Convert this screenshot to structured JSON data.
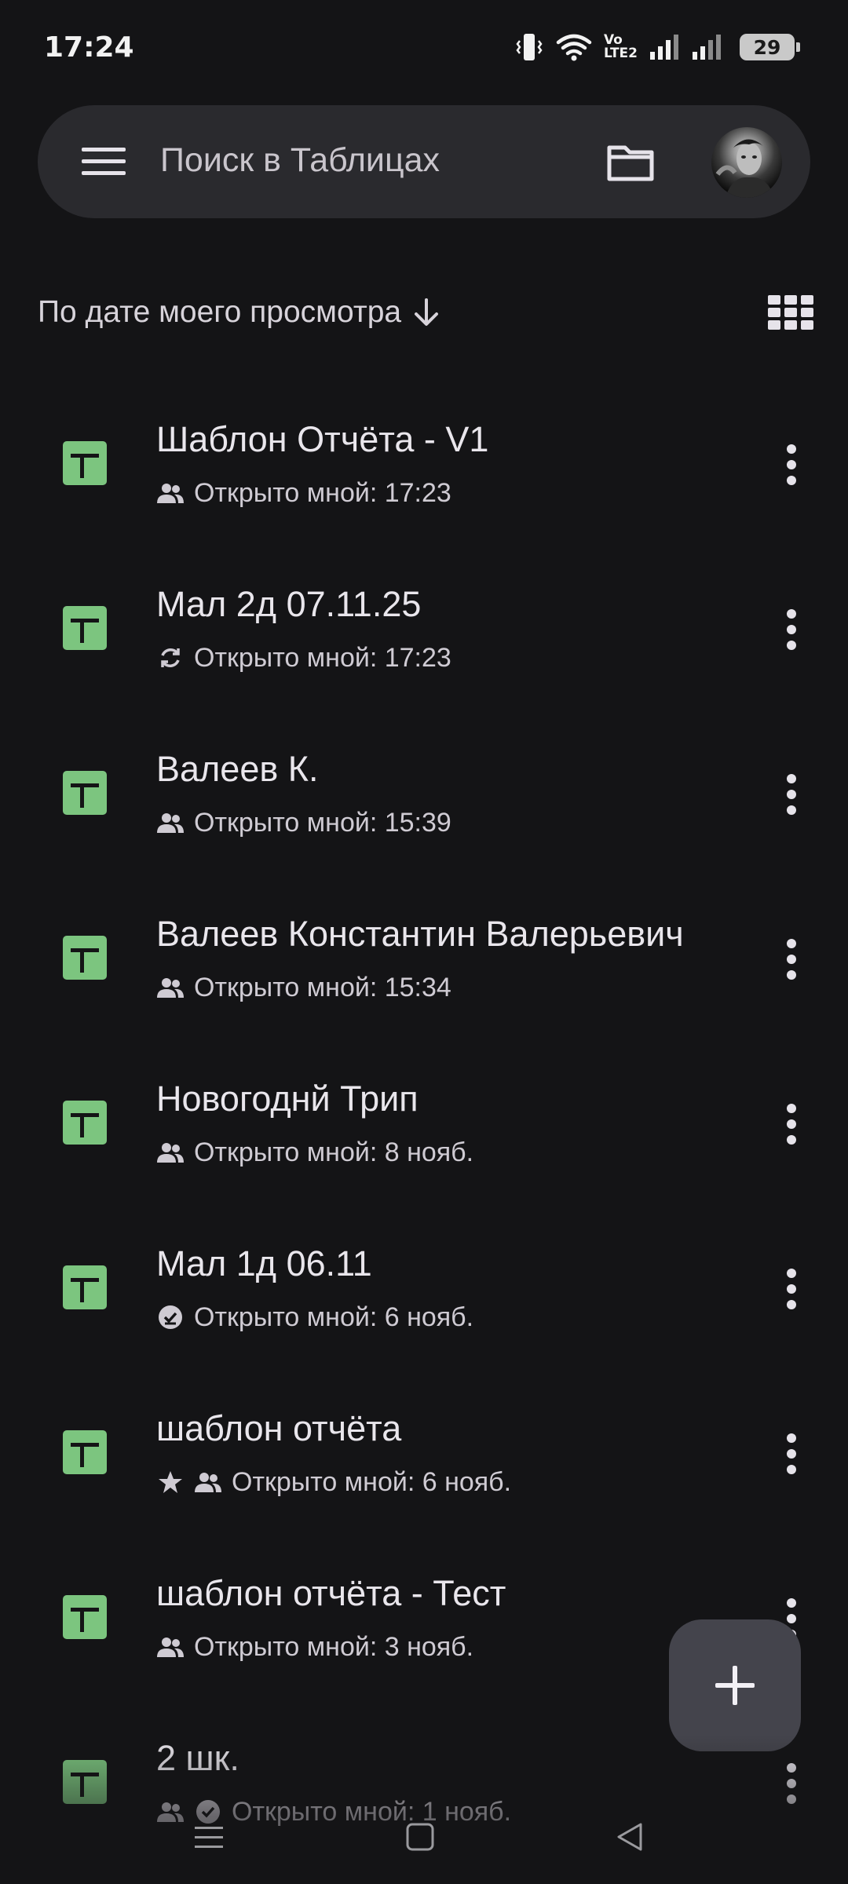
{
  "status_bar": {
    "time": "17:24",
    "network_label_top": "Vo",
    "network_label_bottom": "LTE2",
    "battery": "29",
    "icons": [
      "vibrate-icon",
      "wifi-icon",
      "signal-icon",
      "signal-icon",
      "battery-icon"
    ]
  },
  "search": {
    "placeholder": "Поиск в Таблицах",
    "icons": [
      "menu-icon",
      "folder-icon",
      "avatar"
    ]
  },
  "sort": {
    "label": "По дате моего просмотра",
    "direction_icon": "arrow-down-icon",
    "view_icon": "grid-view-icon"
  },
  "files": [
    {
      "title": "Шаблон Отчёта  - V1",
      "meta": "Открыто мной: 17:23",
      "icons": [
        "shared-icon"
      ]
    },
    {
      "title": "Мал 2д 07.11.25",
      "meta": "Открыто мной: 17:23",
      "icons": [
        "sync-icon"
      ]
    },
    {
      "title": "Валеев К.",
      "meta": "Открыто мной: 15:39",
      "icons": [
        "shared-icon"
      ]
    },
    {
      "title": "Валеев Константин Валерьевич",
      "meta": "Открыто мной: 15:34",
      "icons": [
        "shared-icon"
      ]
    },
    {
      "title": "Новогоднй Трип",
      "meta": "Открыто мной: 8 нояб.",
      "icons": [
        "shared-icon"
      ]
    },
    {
      "title": "Мал 1д 06.11",
      "meta": "Открыто мной: 6 нояб.",
      "icons": [
        "offline-check-icon"
      ]
    },
    {
      "title": "шаблон отчёта",
      "meta": "Открыто мной: 6 нояб.",
      "icons": [
        "star-icon",
        "shared-icon"
      ]
    },
    {
      "title": "шаблон отчёта - Тест",
      "meta": "Открыто мной: 3 нояб.",
      "icons": [
        "shared-icon"
      ]
    },
    {
      "title": "2 шк.",
      "meta": "Открыто мной: 1 нояб.",
      "icons": [
        "shared-icon",
        "offline-check-icon"
      ]
    }
  ],
  "fab": {
    "icon": "plus-icon"
  },
  "nav": {
    "icons": [
      "recents-icon",
      "home-icon",
      "back-icon"
    ]
  },
  "colors": {
    "background": "#141416",
    "search_bar": "#2a2a2e",
    "sheets_green": "#7cc57f",
    "fab": "#44444c"
  }
}
